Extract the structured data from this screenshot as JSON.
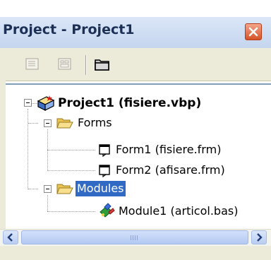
{
  "window": {
    "title": "Project - Project1",
    "close_icon": "close-icon"
  },
  "toolbar": {
    "buttons": [
      {
        "name": "view-code-button",
        "icon": "view-code-icon",
        "enabled": false
      },
      {
        "name": "view-object-button",
        "icon": "view-object-icon",
        "enabled": false
      },
      {
        "name": "toggle-folders-button",
        "icon": "folder-icon",
        "enabled": true
      }
    ]
  },
  "tree": {
    "project": {
      "label": "Project1 (fisiere.vbp)",
      "icon": "vb-project-icon",
      "expanded": true
    },
    "folders": [
      {
        "label": "Forms",
        "icon": "open-folder-icon",
        "expanded": true,
        "selected": false,
        "items": [
          {
            "label": "Form1 (fisiere.frm)",
            "icon": "form-icon"
          },
          {
            "label": "Form2 (afisare.frm)",
            "icon": "form-icon"
          }
        ]
      },
      {
        "label": "Modules",
        "icon": "open-folder-icon",
        "expanded": true,
        "selected": true,
        "items": [
          {
            "label": "Module1 (articol.bas)",
            "icon": "module-icon"
          }
        ]
      }
    ]
  },
  "scrollbar": {
    "orientation": "horizontal",
    "left_icon": "arrow-left-icon",
    "right_icon": "arrow-right-icon"
  }
}
